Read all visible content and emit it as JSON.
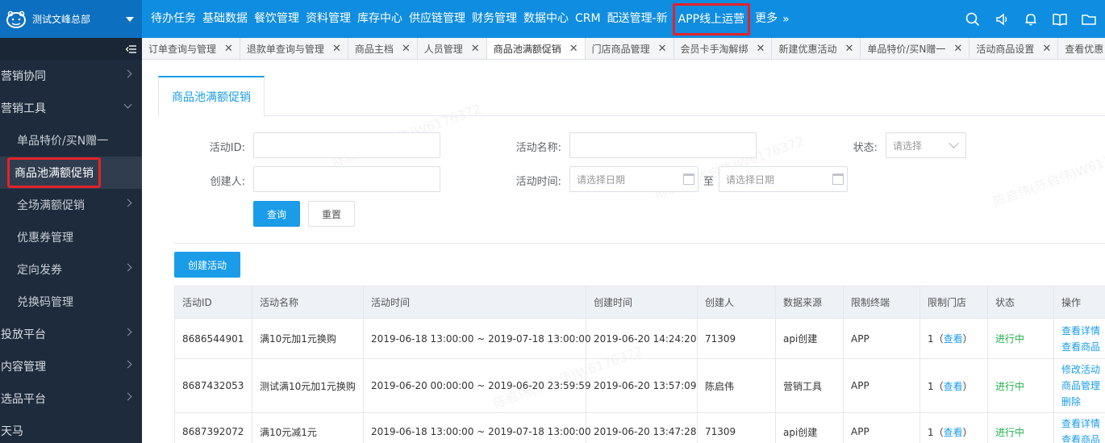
{
  "brand": {
    "name": "测试文峰总部"
  },
  "topnav": {
    "items": [
      "待办任务",
      "基础数据",
      "餐饮管理",
      "资料管理",
      "库存中心",
      "供应链管理",
      "财务管理",
      "数据中心",
      "CRM",
      "配送管理-新",
      "APP线上运营",
      "更多"
    ],
    "highlighted": "APP线上运营",
    "icons": [
      "search-icon",
      "speaker-icon",
      "bell-icon",
      "book-icon",
      "folder-icon"
    ]
  },
  "sidebar": {
    "items": [
      {
        "label": "营销协同",
        "level": 1,
        "arrow": "right"
      },
      {
        "label": "营销工具",
        "level": 1,
        "arrow": "down"
      },
      {
        "label": "单品特价/买N赠一",
        "level": 2,
        "arrow": ""
      },
      {
        "label": "商品池满额促销",
        "level": 2,
        "arrow": "",
        "active": true
      },
      {
        "label": "全场满额促销",
        "level": 2,
        "arrow": "right"
      },
      {
        "label": "优惠券管理",
        "level": 2,
        "arrow": ""
      },
      {
        "label": "定向发券",
        "level": 2,
        "arrow": "right"
      },
      {
        "label": "兑换码管理",
        "level": 2,
        "arrow": ""
      },
      {
        "label": "投放平台",
        "level": 1,
        "arrow": "right"
      },
      {
        "label": "内容管理",
        "level": 1,
        "arrow": "right"
      },
      {
        "label": "选品平台",
        "level": 1,
        "arrow": "right"
      },
      {
        "label": "天马",
        "level": 1,
        "arrow": ""
      }
    ]
  },
  "tabs": [
    {
      "label": "订单查询与管理",
      "active": false
    },
    {
      "label": "退款单查询与管理",
      "active": false
    },
    {
      "label": "商品主档",
      "active": false
    },
    {
      "label": "人员管理",
      "active": false
    },
    {
      "label": "商品池满额促销",
      "active": true
    },
    {
      "label": "门店商品管理",
      "active": false
    },
    {
      "label": "会员卡手淘解绑",
      "active": false
    },
    {
      "label": "新建优惠活动",
      "active": false
    },
    {
      "label": "单品特价/买N赠一",
      "active": false
    },
    {
      "label": "活动商品设置",
      "active": false
    },
    {
      "label": "查看优惠",
      "active": false
    }
  ],
  "page": {
    "tab_title": "商品池满额促销",
    "form": {
      "activity_id_label": "活动ID:",
      "activity_name_label": "活动名称:",
      "status_label": "状态:",
      "status_placeholder": "请选择",
      "creator_label": "创建人:",
      "activity_time_label": "活动时间:",
      "date_placeholder": "请选择日期",
      "to_label": "至",
      "query_button": "查询",
      "reset_button": "重置"
    },
    "create_button": "创建活动"
  },
  "table": {
    "columns": [
      "活动ID",
      "活动名称",
      "活动时间",
      "创建时间",
      "创建人",
      "数据来源",
      "限制终端",
      "限制门店",
      "状态",
      "操作"
    ],
    "rows": [
      {
        "id": "8686544901",
        "name": "满10元加1元换购",
        "time": "2019-06-18 13:00:00 ~ 2019-07-18 13:00:00",
        "created": "2019-06-20 14:24:20",
        "creator": "71309",
        "source": "api创建",
        "terminal": "APP",
        "stores_count": "1",
        "stores_link": "查看",
        "status": "进行中",
        "ops": [
          "查看详情",
          "查看商品"
        ]
      },
      {
        "id": "8687432053",
        "name": "测试满10元加1元换购",
        "time": "2019-06-20 00:00:00 ~ 2019-06-20 23:59:59",
        "created": "2019-06-20 13:57:09",
        "creator": "陈启伟",
        "source": "营销工具",
        "terminal": "APP",
        "stores_count": "1",
        "stores_link": "查看",
        "status": "进行中",
        "ops": [
          "修改活动",
          "商品管理",
          "删除"
        ]
      },
      {
        "id": "8687392072",
        "name": "满10元减1元",
        "time": "2019-06-18 13:00:00 ~ 2019-07-18 13:00:00",
        "created": "2019-06-20 13:47:28",
        "creator": "71309",
        "source": "api创建",
        "terminal": "APP",
        "stores_count": "1",
        "stores_link": "查看",
        "status": "进行中",
        "ops": [
          "查看详情",
          "查看商品"
        ]
      }
    ]
  },
  "watermark": "陈启伟(陈启伟)W6176372",
  "colors": {
    "topbar": "#0f8de0",
    "brand_bg": "#0d6fbf",
    "sidebar": "#1e2b3c",
    "accent": "#1a9ce8",
    "status_running": "#22b14c",
    "highlight_box": "#e6212a"
  }
}
